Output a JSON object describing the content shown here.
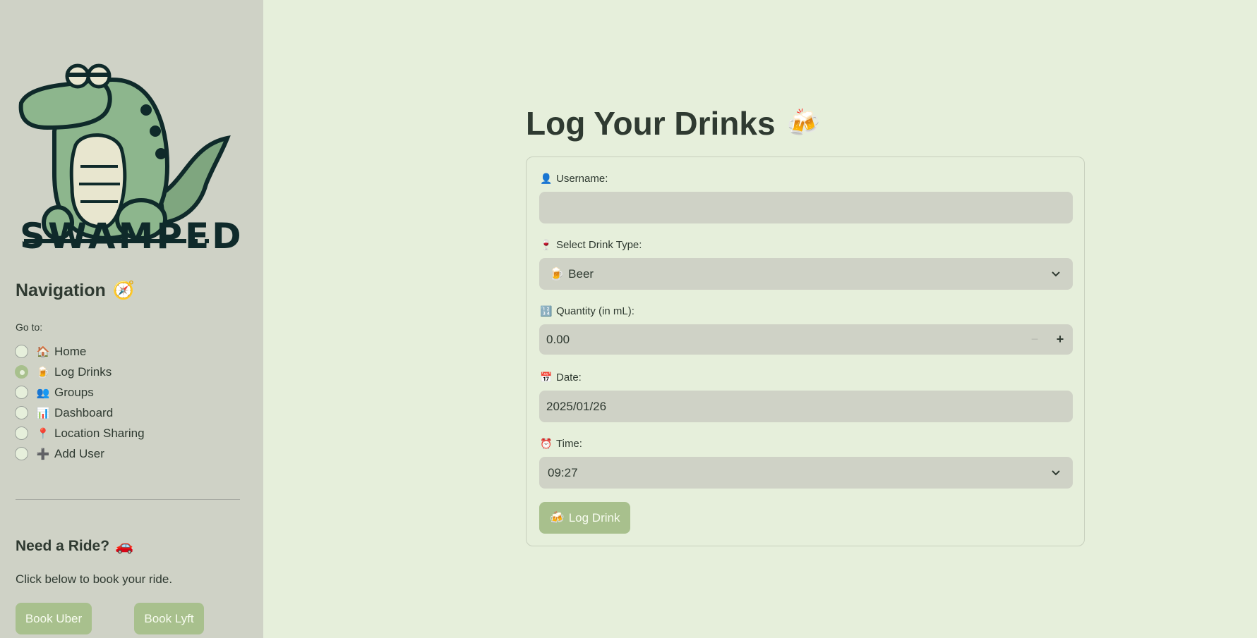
{
  "sidebar": {
    "logo_text": "SWAMPED",
    "nav_title": "Navigation",
    "nav_title_icon": "🧭",
    "goto_label": "Go to:",
    "items": [
      {
        "label": "Home",
        "icon": "🏠",
        "checked": false
      },
      {
        "label": "Log Drinks",
        "icon": "🍺",
        "checked": true
      },
      {
        "label": "Groups",
        "icon": "👥",
        "checked": false
      },
      {
        "label": "Dashboard",
        "icon": "📊",
        "checked": false
      },
      {
        "label": "Location Sharing",
        "icon": "📍",
        "checked": false
      },
      {
        "label": "Add User",
        "icon": "➕",
        "checked": false
      }
    ],
    "ride_title": "Need a Ride?",
    "ride_icon": "🚗",
    "ride_text": "Click below to book your ride.",
    "uber_label": "Book Uber",
    "lyft_label": "Book Lyft"
  },
  "main": {
    "title": "Log Your Drinks",
    "title_icon": "🍻",
    "username": {
      "label": "Username:",
      "icon": "👤",
      "value": "",
      "placeholder": ""
    },
    "drink_type": {
      "label": "Select Drink Type:",
      "icon": "🍷",
      "value": "Beer",
      "value_icon": "🍺"
    },
    "quantity": {
      "label": "Quantity (in mL):",
      "icon": "🔢",
      "value": "0.00",
      "minus": "−",
      "plus": "+"
    },
    "date": {
      "label": "Date:",
      "icon": "📅",
      "value": "2025/01/26"
    },
    "time": {
      "label": "Time:",
      "icon": "⏰",
      "value": "09:27"
    },
    "submit_label": "Log Drink",
    "submit_icon": "🍻"
  },
  "colors": {
    "background": "#e6efdb",
    "sidebar": "#cfd2c6",
    "accent": "#a8c08d",
    "text": "#2f3a31"
  }
}
